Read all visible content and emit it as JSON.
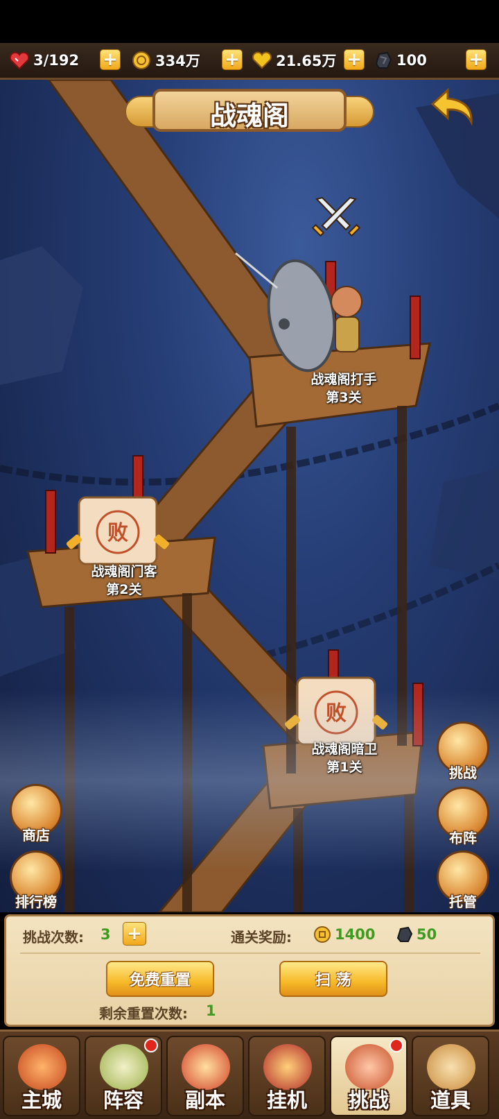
{
  "resources": {
    "stamina": "3/192",
    "coins": "334万",
    "gems": "21.65万",
    "ore": "100"
  },
  "title": "战魂阁",
  "stages": [
    {
      "name": "战魂阁打手",
      "level": "第3关"
    },
    {
      "name": "战魂阁门客",
      "level": "第2关",
      "seal": "败"
    },
    {
      "name": "战魂阁暗卫",
      "level": "第1关",
      "seal": "败"
    }
  ],
  "side_left": [
    "商店",
    "排行榜"
  ],
  "side_right": [
    "挑战",
    "布阵",
    "托管"
  ],
  "panel": {
    "challenge_label": "挑战次数:",
    "challenge_count": "3",
    "reward_label": "通关奖励:",
    "reward_coins": "1400",
    "reward_ore": "50",
    "reset_button": "免费重置",
    "sweep_button": "扫 荡",
    "remaining_label": "剩余重置次数:",
    "remaining_count": "1"
  },
  "nav": [
    "主城",
    "阵容",
    "副本",
    "挂机",
    "挑战",
    "道具"
  ],
  "colors": {
    "accent": "#f6b928",
    "green": "#3f9a22",
    "bg": "#263e76"
  }
}
